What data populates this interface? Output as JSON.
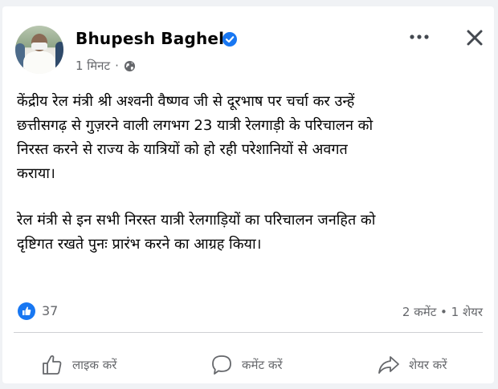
{
  "post": {
    "author": "Bhupesh Baghel",
    "time": "1 मिनट",
    "separator": "·",
    "paragraphs": [
      "केंद्रीय रेल मंत्री श्री अश्वनी वैष्णव जी से दूरभाष पर चर्चा कर उन्हें\nछत्तीसगढ़ से गुज़रने वाली लगभग 23 यात्री रेलगाड़ी के परिचालन को\nनिरस्त करने से राज्य के यात्रियों को हो रही परेशानियों से अवगत\nकराया।",
      "रेल मंत्री से इन सभी निरस्त यात्री रेलगाड़ियों का परिचालन जनहित को\nदृष्टिगत रखते पुनः प्रारंभ करने का आग्रह किया।"
    ]
  },
  "reactions": {
    "count": "37",
    "summary": "2 कमेंट • 1 शेयर"
  },
  "actions": {
    "like": "लाइक करें",
    "comment": "कमेंट करें",
    "share": "शेयर करें"
  },
  "icons": {
    "verified": "verified-badge-icon",
    "privacy": "globe-icon",
    "more": "more-options-icon",
    "close": "close-icon",
    "like_reaction": "thumbs-up-icon"
  },
  "colors": {
    "accent": "#1877f2",
    "secondary_text": "#65676b"
  }
}
